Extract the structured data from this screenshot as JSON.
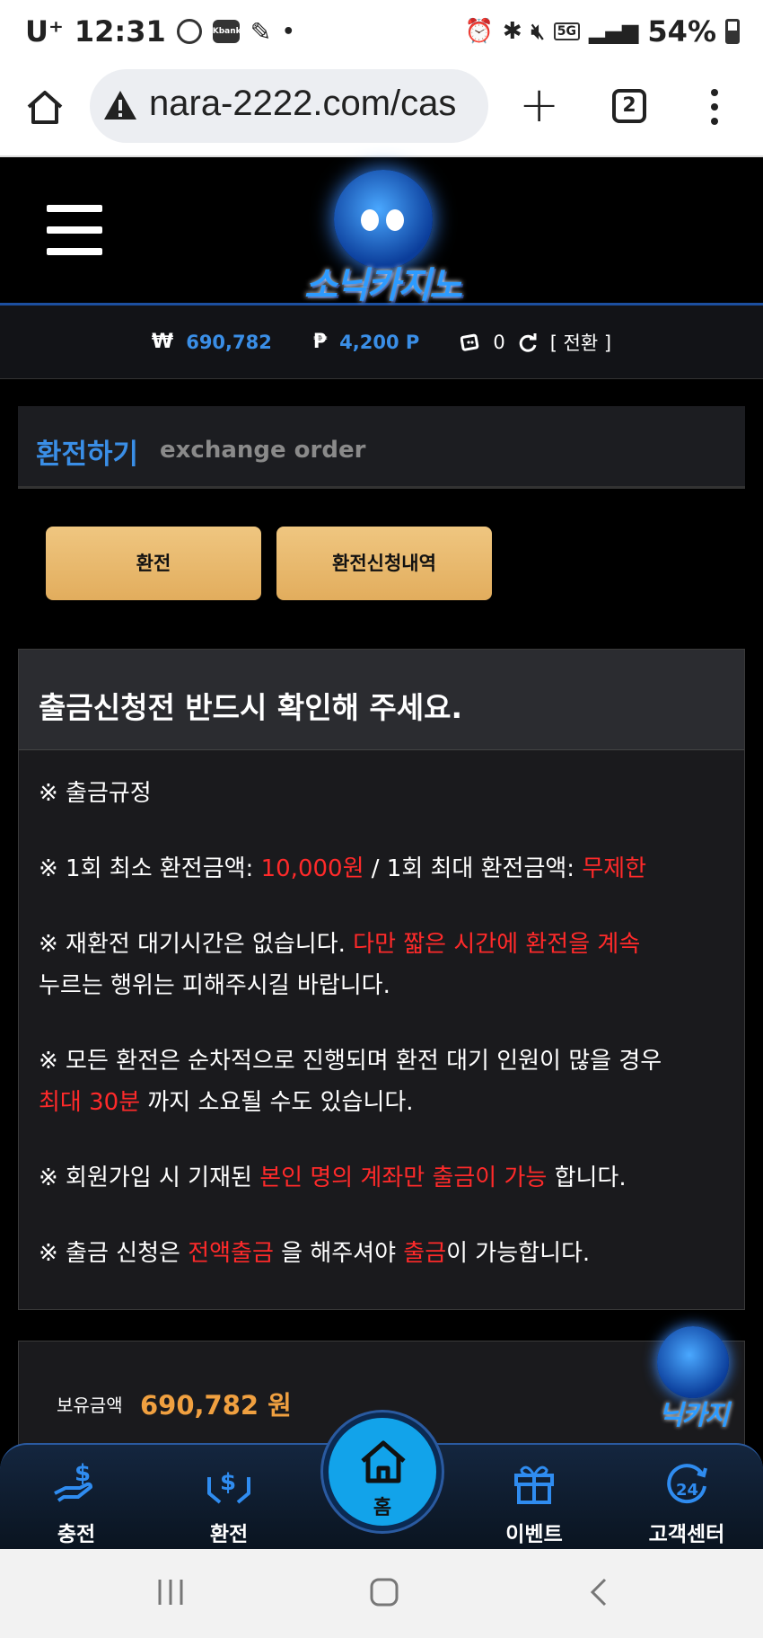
{
  "status_bar": {
    "carrier": "U⁺",
    "time": "12:31",
    "kbank": "Kbank",
    "dot": "•",
    "network": "5G",
    "battery": "54%"
  },
  "browser": {
    "url": "nara-2222.com/cas",
    "tab_count": "2",
    "new_tab": "+"
  },
  "site": {
    "logo_text": "소닉카지노"
  },
  "balance_bar": {
    "won_symbol": "₩",
    "won_value": "690,782",
    "point_symbol": "₱",
    "point_value": "4,200 P",
    "chip_value": "0",
    "convert_label": "[ 전환 ]"
  },
  "page_title": {
    "ko": "환전하기",
    "en": "exchange order"
  },
  "buttons": {
    "exchange": "환전",
    "history": "환전신청내역"
  },
  "notice": {
    "header": "출금신청전 반드시 확인해 주세요.",
    "l1": "※ 출금규정",
    "l2a": "※ 1회 최소 환전금액: ",
    "l2b": "10,000원",
    "l2c": " / 1회 최대 환전금액: ",
    "l2d": "무제한",
    "l3a": "※ 재환전 대기시간은 없습니다. ",
    "l3b": "다만 짧은 시간에 환전을 계속",
    "l4": "누르는 행위는 피해주시길 바랍니다.",
    "l5": "※ 모든 환전은 순차적으로 진행되며 환전 대기 인원이 많을 경우",
    "l6a": "최대 30분",
    "l6b": " 까지 소요될 수도 있습니다.",
    "l7a": "※ 회원가입 시 기재된 ",
    "l7b": "본인 명의 계좌만 출금이 가능",
    "l7c": " 합니다.",
    "l8a": "※ 출금 신청은 ",
    "l8b": "전액출금",
    "l8c": " 을 해주셔야 ",
    "l8d": "출금",
    "l8e": "이 가능합니다."
  },
  "holding": {
    "label": "보유금액",
    "amount": "690,782 원"
  },
  "float_logo": "닉카지",
  "bottom_nav": {
    "deposit": "충전",
    "withdraw": "환전",
    "home": "홈",
    "event": "이벤트",
    "support": "고객센터"
  },
  "colors": {
    "accent_blue": "#3a8ee6",
    "warning_red": "#ff2a2a",
    "gold_button": "#e8b86a",
    "amount_orange": "#f0a040"
  }
}
